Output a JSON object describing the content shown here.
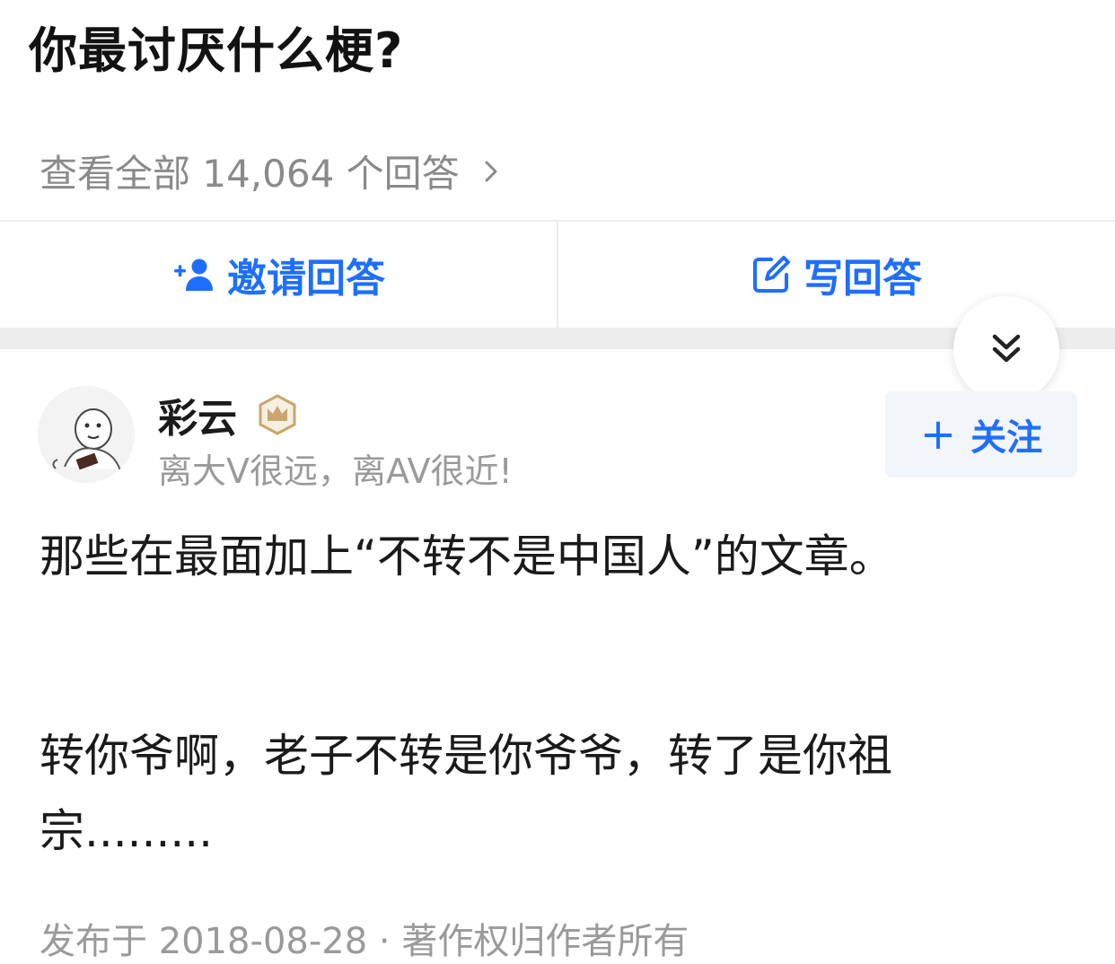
{
  "question": {
    "title": "你最讨厌什么梗?"
  },
  "answers_link": {
    "label": "查看全部 14,064 个回答"
  },
  "actions": {
    "invite_label": "邀请回答",
    "write_label": "写回答"
  },
  "author": {
    "name": "彩云",
    "bio": "离大V很远，离AV很近!",
    "follow_label": "关注"
  },
  "answer": {
    "paragraphs": [
      "那些在最面加上“不转不是中国人”的文章。",
      "转你爷啊，老子不转是你爷爷，转了是你祖宗........."
    ],
    "meta": "发布于 2018-08-28 · 著作权归作者所有"
  },
  "colors": {
    "accent": "#1e6fff",
    "muted_text": "#8a8a8a",
    "divider": "#ececec",
    "badge_gold": "#c9a66b"
  },
  "icons": {
    "view_all": "chevron-right-icon",
    "invite": "add-user-icon",
    "write": "edit-icon",
    "collapse": "double-chevron-down-icon",
    "badge": "crown-badge-icon",
    "follow": "plus-icon"
  }
}
